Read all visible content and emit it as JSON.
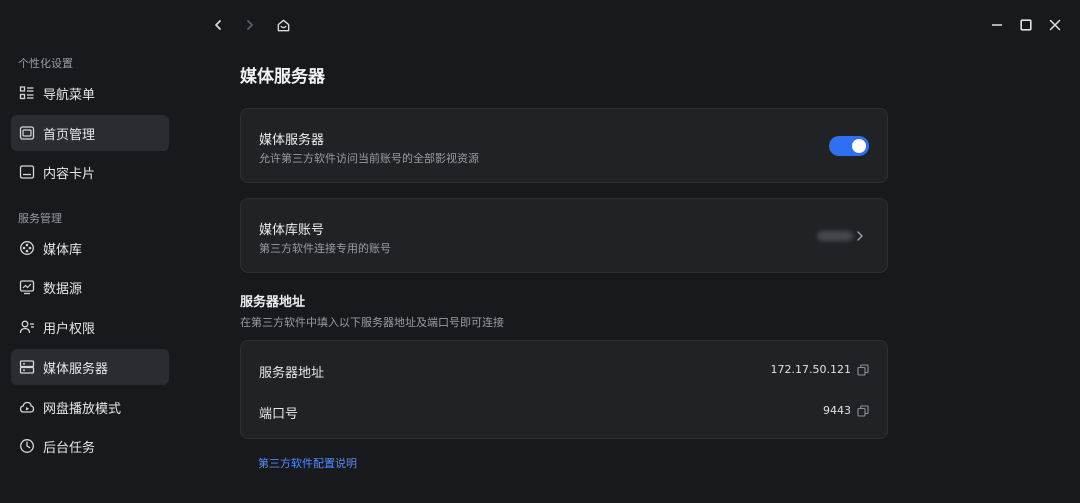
{
  "topbar": {
    "back_icon": "chevron-left-icon",
    "forward_icon": "chevron-right-icon",
    "home_icon": "home-icon",
    "window_controls": [
      "minimize-icon",
      "maximize-icon",
      "close-icon"
    ]
  },
  "sidebar": {
    "sections": [
      {
        "label": "个性化设置",
        "items": [
          {
            "label": "导航菜单",
            "icon": "list-icon",
            "active": false
          },
          {
            "label": "首页管理",
            "icon": "home-page-icon",
            "active": false
          },
          {
            "label": "内容卡片",
            "icon": "card-icon",
            "active": false
          }
        ]
      },
      {
        "label": "服务管理",
        "items": [
          {
            "label": "媒体库",
            "icon": "media-library-icon",
            "active": false
          },
          {
            "label": "数据源",
            "icon": "data-source-icon",
            "active": false
          },
          {
            "label": "用户权限",
            "icon": "user-permission-icon",
            "active": false
          },
          {
            "label": "媒体服务器",
            "icon": "server-icon",
            "active": true
          },
          {
            "label": "网盘播放模式",
            "icon": "cloud-play-icon",
            "active": false
          },
          {
            "label": "后台任务",
            "icon": "clock-icon",
            "active": false
          }
        ]
      }
    ]
  },
  "main": {
    "title": "媒体服务器",
    "media_server_card": {
      "title": "媒体服务器",
      "description": "允许第三方软件访问当前账号的全部影视资源",
      "toggle_on": true
    },
    "account_card": {
      "title": "媒体库账号",
      "description": "第三方软件连接专用的账号"
    },
    "address_section": {
      "heading": "服务器地址",
      "description": "在第三方软件中填入以下服务器地址及端口号即可连接",
      "rows": [
        {
          "label": "服务器地址",
          "value": "172.17.50.121"
        },
        {
          "label": "端口号",
          "value": "9443"
        }
      ]
    },
    "help_link": "第三方软件配置说明"
  },
  "colors": {
    "background": "#18191d",
    "card": "#202226",
    "accent": "#2f6ff2",
    "link": "#4f8dff"
  }
}
